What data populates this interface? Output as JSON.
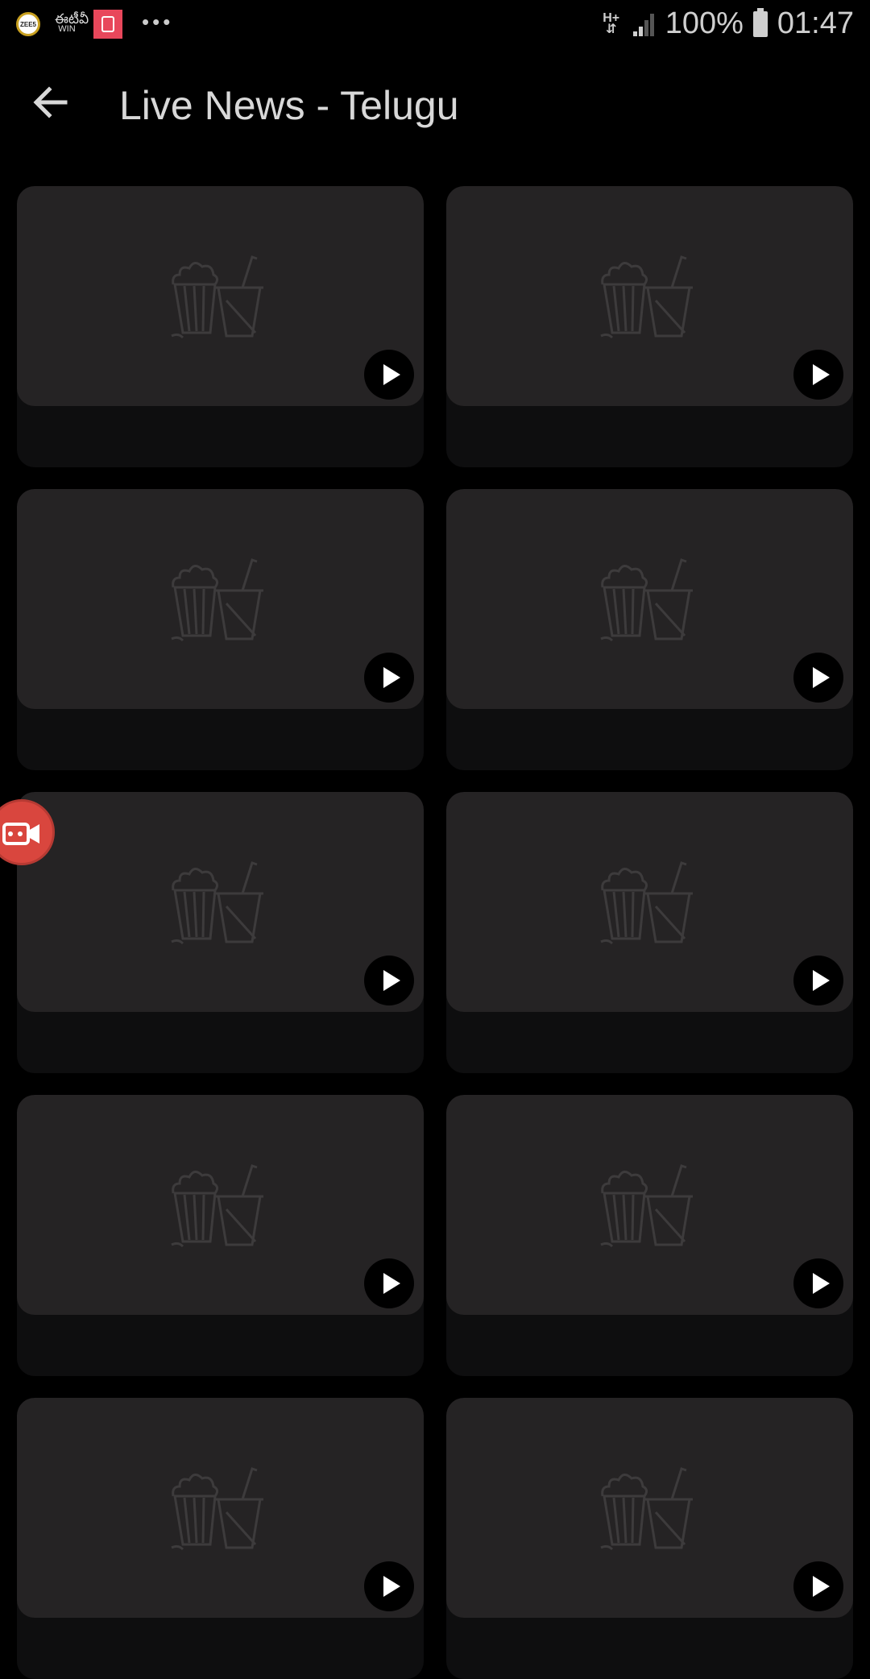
{
  "status_bar": {
    "icons": [
      "zee5-app-icon",
      "etv-win-app-icon",
      "red-app-icon",
      "more-notifications-icon"
    ],
    "zee_label": "ZEE5",
    "etv_script": "ఈటీవీ",
    "etv_label": "WIN",
    "more_label": "•••",
    "network_label": "H+",
    "network_arrows": "⇵",
    "battery_percent": "100%",
    "time": "01:47"
  },
  "app_bar": {
    "back_icon": "arrow-left-icon",
    "title": "Live News - Telugu"
  },
  "grid": {
    "columns": 2,
    "cards": [
      {
        "thumbnail": "popcorn-drink-placeholder",
        "action": "play-icon"
      },
      {
        "thumbnail": "popcorn-drink-placeholder",
        "action": "play-icon"
      },
      {
        "thumbnail": "popcorn-drink-placeholder",
        "action": "play-icon"
      },
      {
        "thumbnail": "popcorn-drink-placeholder",
        "action": "play-icon"
      },
      {
        "thumbnail": "popcorn-drink-placeholder",
        "action": "play-icon"
      },
      {
        "thumbnail": "popcorn-drink-placeholder",
        "action": "play-icon"
      },
      {
        "thumbnail": "popcorn-drink-placeholder",
        "action": "play-icon"
      },
      {
        "thumbnail": "popcorn-drink-placeholder",
        "action": "play-icon"
      },
      {
        "thumbnail": "popcorn-drink-placeholder",
        "action": "play-icon"
      },
      {
        "thumbnail": "popcorn-drink-placeholder",
        "action": "play-icon"
      }
    ]
  },
  "floating_button": {
    "icon": "video-record-icon"
  },
  "colors": {
    "background": "#000000",
    "card": "#0e0e0f",
    "thumbnail": "#252324",
    "record_button": "#d9463e"
  }
}
